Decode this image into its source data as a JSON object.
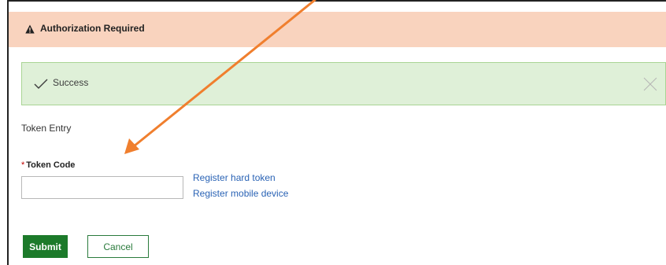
{
  "header": {
    "title": "Authorization Required",
    "icon": "warning-icon"
  },
  "alert": {
    "text": "Success",
    "icon": "check-icon",
    "close_icon": "close-icon"
  },
  "form": {
    "section_title": "Token Entry",
    "token_label": "Token Code",
    "required_marker": "*",
    "token_value": "",
    "links": {
      "register_hard_token": "Register hard token",
      "register_mobile_device": "Register mobile device"
    },
    "buttons": {
      "submit": "Submit",
      "cancel": "Cancel"
    }
  },
  "colors": {
    "header_bg": "#f9d3be",
    "alert_bg": "#dff0d8",
    "submit_bg": "#1c7a2a",
    "link": "#2a63b5",
    "annotation_arrow": "#f07f2e"
  }
}
